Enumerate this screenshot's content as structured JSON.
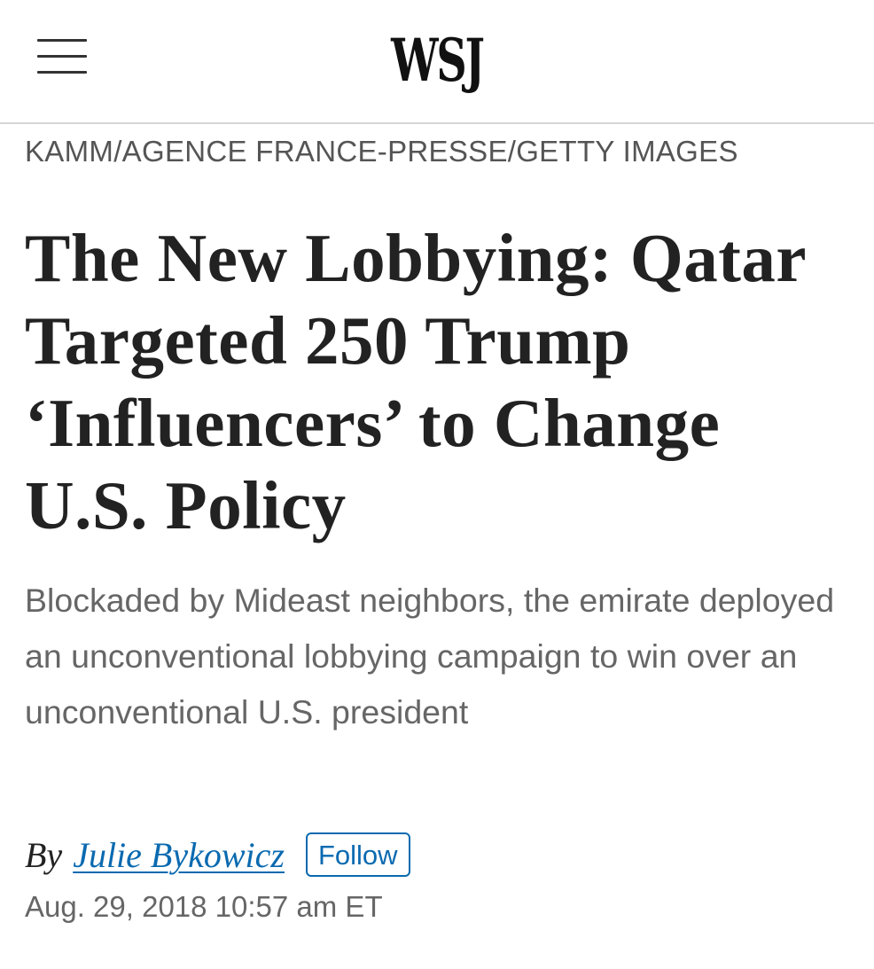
{
  "header": {
    "logo_text": "WSJ",
    "menu_icon": "hamburger-menu-icon"
  },
  "article": {
    "photo_credit": "KAMM/AGENCE FRANCE-PRESSE/GETTY IMAGES",
    "headline": "The New Lobbying: Qatar Targeted 250 Trump ‘Influencers’ to Change U.S. Policy",
    "dek": "Blockaded by Mideast neighbors, the emirate deployed an unconventional lobbying campaign to win over an unconventional U.S. president",
    "byline_prefix": "By",
    "author": "Julie Bykowicz",
    "follow_label": "Follow",
    "timestamp": "Aug. 29, 2018 10:57 am ET"
  },
  "colors": {
    "link": "#0a6ab0",
    "text": "#222222",
    "muted": "#666666",
    "divider": "#d6d6d6"
  }
}
